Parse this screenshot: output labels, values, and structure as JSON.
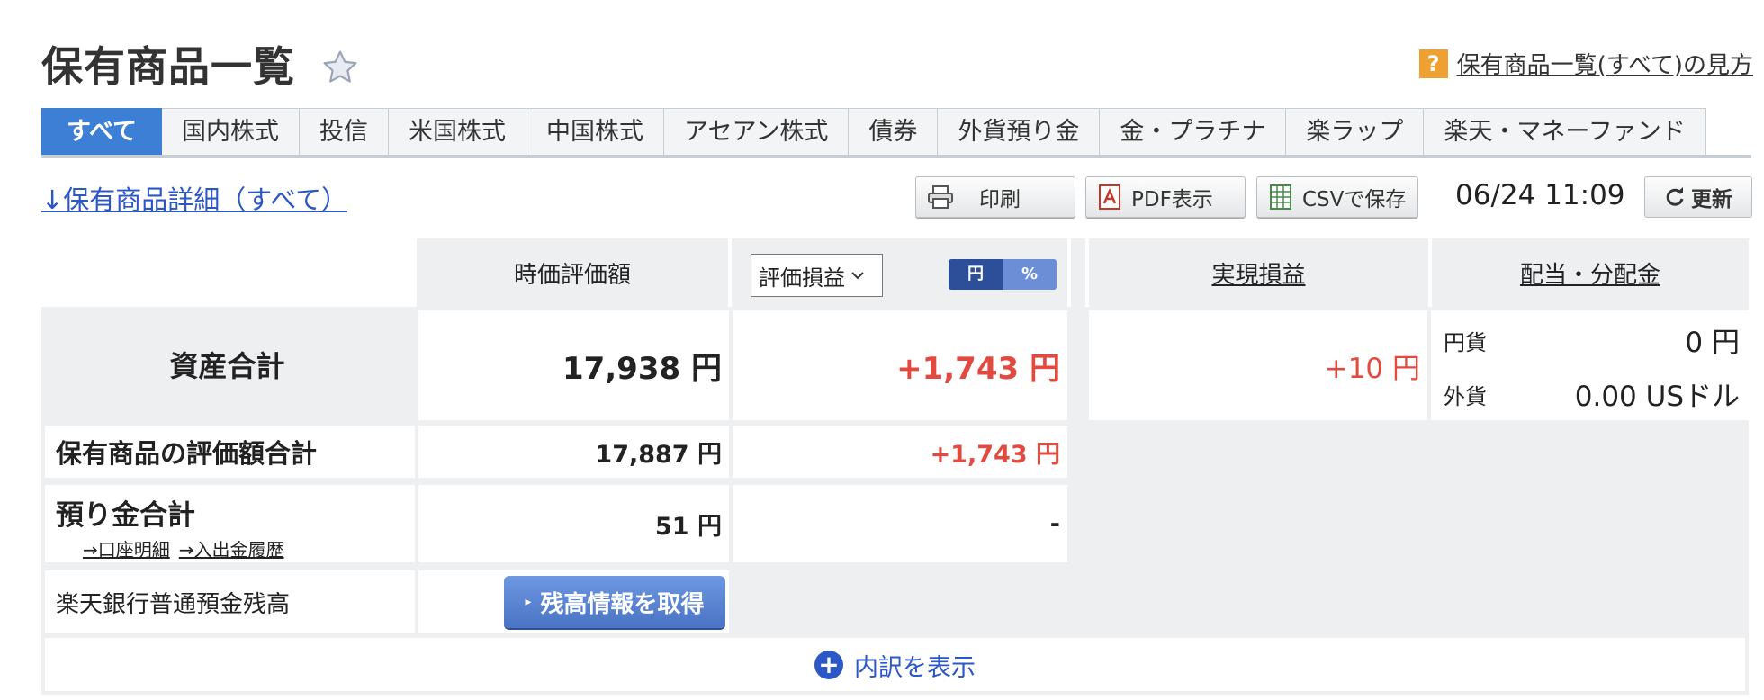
{
  "header": {
    "title": "保有商品一覧",
    "help_icon": "?",
    "help_link": "保有商品一覧(すべて)の見方"
  },
  "tabs": [
    {
      "label": "すべて",
      "active": true
    },
    {
      "label": "国内株式"
    },
    {
      "label": "投信"
    },
    {
      "label": "米国株式"
    },
    {
      "label": "中国株式"
    },
    {
      "label": "アセアン株式"
    },
    {
      "label": "債券"
    },
    {
      "label": "外貨預り金"
    },
    {
      "label": "金・プラチナ"
    },
    {
      "label": "楽ラップ"
    },
    {
      "label": "楽天・マネーファンド"
    }
  ],
  "toolbar": {
    "detail_link": "↓保有商品詳細（すべて）",
    "print_label": "印刷",
    "pdf_label": "PDF表示",
    "csv_label": "CSVで保存",
    "timestamp": "06/24 11:09",
    "refresh_label": "更新"
  },
  "table": {
    "col_market_value": "時価評価額",
    "col_select_value": "評価損益",
    "unit_yen": "円",
    "unit_percent": "%",
    "col_realized": "実現損益",
    "col_dividend": "配当・分配金",
    "total_assets": {
      "label": "資産合計",
      "value": "17,938 円",
      "gain": "+1,743 円",
      "realized": "+10 円"
    },
    "dividend": {
      "jpy_label": "円貨",
      "jpy_value": "0 円",
      "fx_label": "外貨",
      "fx_value": "0.00 USドル"
    },
    "holdings": {
      "label": "保有商品の評価額合計",
      "value": "17,887 円",
      "gain": "+1,743 円"
    },
    "deposits": {
      "label": "預り金合計",
      "link_account": "→口座明細",
      "link_history": "→入出金履歴",
      "value": "51 円",
      "gain": "-"
    },
    "bank": {
      "label": "楽天銀行普通預金残高",
      "button": "残高情報を取得"
    },
    "expand_label": "内訳を表示"
  }
}
